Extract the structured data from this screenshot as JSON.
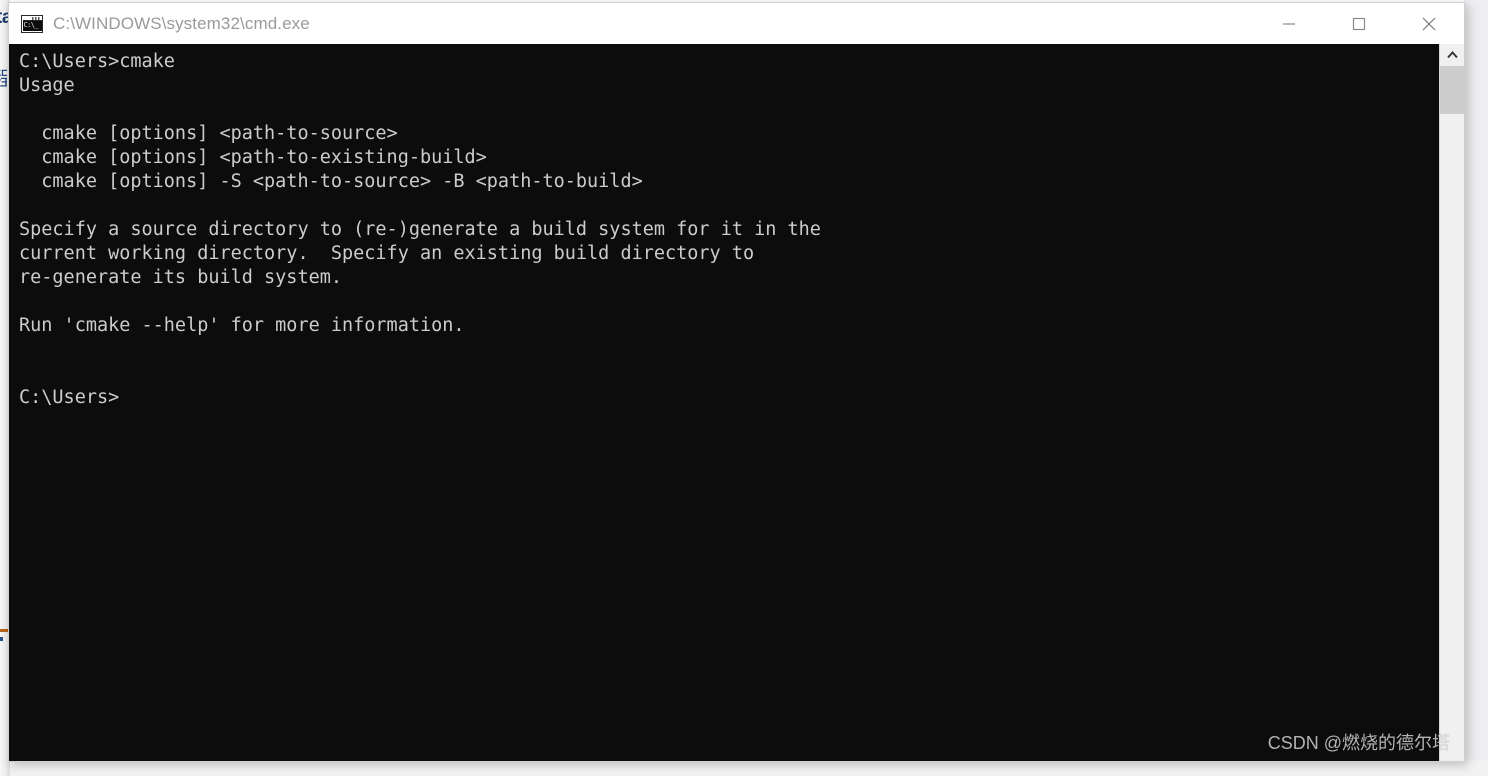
{
  "window": {
    "title": "C:\\WINDOWS\\system32\\cmd.exe",
    "icon": "cmd-console-icon",
    "icon_glyph": "C:\\_",
    "background_color": "#0c0c0c",
    "text_color": "#ccccca",
    "titlebar_color": "#ffffff",
    "controls": {
      "minimize_label": "Minimize",
      "maximize_label": "Maximize",
      "close_label": "Close"
    }
  },
  "console": {
    "lines": [
      "C:\\Users>cmake",
      "Usage",
      "",
      "  cmake [options] <path-to-source>",
      "  cmake [options] <path-to-existing-build>",
      "  cmake [options] -S <path-to-source> -B <path-to-build>",
      "",
      "Specify a source directory to (re-)generate a build system for it in the",
      "current working directory.  Specify an existing build directory to",
      "re-generate its build system.",
      "",
      "Run 'cmake --help' for more information.",
      "",
      "",
      "C:\\Users>"
    ],
    "command_entered": "cmake",
    "prompt": "C:\\Users>",
    "final_prompt": "C:\\Users>"
  },
  "scrollbar": {
    "up_arrow": "chevron-up-icon",
    "down_arrow": "chevron-down-icon",
    "thumb_position_percent": 0
  },
  "watermark": {
    "text": "CSDN @燃烧的德尔塔"
  },
  "background_fragments": {
    "top_text": "ta",
    "mid_text": "程"
  }
}
